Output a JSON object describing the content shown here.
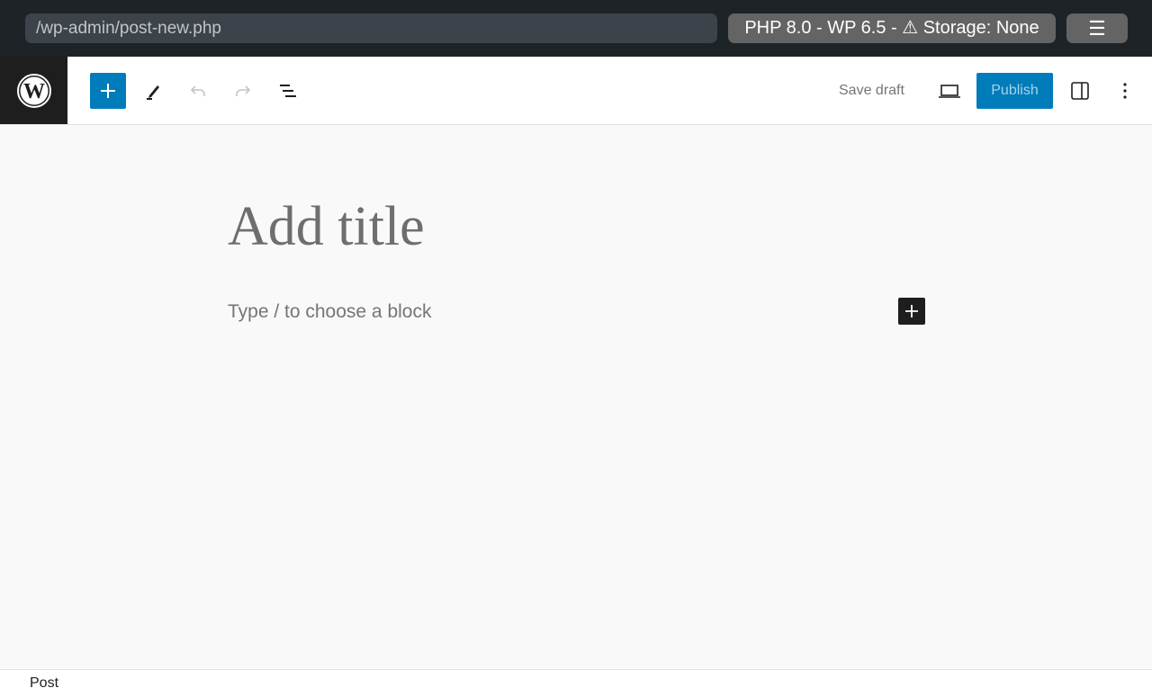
{
  "browser": {
    "url": "/wp-admin/post-new.php",
    "environment": "PHP 8.0 - WP 6.5 - ⚠ Storage: None",
    "menu_icon": "☰"
  },
  "toolbar": {
    "logo": "wordpress-logo",
    "inserter_icon": "plus-icon",
    "tools_icon": "pencil-icon",
    "undo_icon": "undo-icon",
    "redo_icon": "redo-icon",
    "list_view_icon": "list-view-icon",
    "save_draft_label": "Save draft",
    "preview_icon": "desktop-icon",
    "publish_label": "Publish",
    "settings_icon": "sidebar-icon",
    "options_icon": "more-vertical-icon"
  },
  "editor": {
    "title_placeholder": "Add title",
    "block_placeholder": "Type / to choose a block"
  },
  "footer": {
    "breadcrumb": "Post"
  }
}
